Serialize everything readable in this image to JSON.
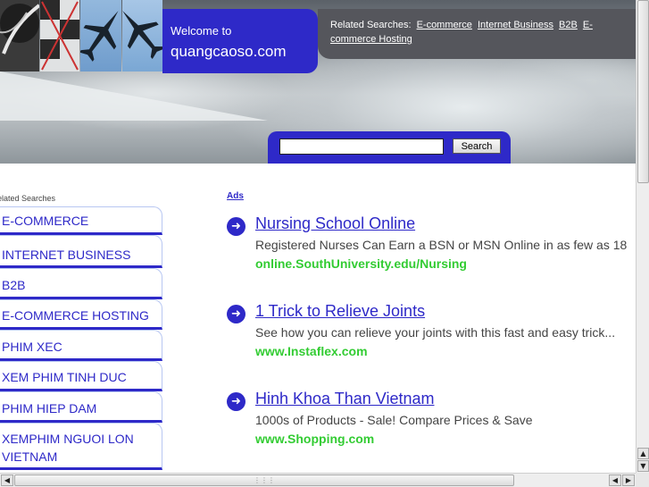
{
  "header": {
    "welcome_line1": "Welcome to",
    "welcome_line2": "quangcaoso.com",
    "related_label": "Related Searches:",
    "related_links": [
      "E-commerce",
      "Internet Business",
      "B2B",
      "E-commerce Hosting"
    ]
  },
  "search": {
    "value": "",
    "button_label": "Search"
  },
  "left": {
    "heading": "elated Searches",
    "items": [
      "E-COMMERCE",
      "INTERNET BUSINESS",
      "B2B",
      "E-COMMERCE HOSTING",
      "PHIM XEC",
      "XEM PHIM TINH DUC",
      "PHIM HIEP DAM",
      "XEMPHIM NGUOI LON VIETNAM"
    ]
  },
  "ads": {
    "label": "Ads",
    "items": [
      {
        "title": "Nursing School Online",
        "description": "Registered Nurses Can Earn a BSN or MSN Online in as few as 18",
        "url": "online.SouthUniversity.edu/Nursing"
      },
      {
        "title": "1 Trick to Relieve Joints",
        "description": "See how you can relieve your joints with this fast and easy trick...",
        "url": "www.Instaflex.com"
      },
      {
        "title": "Hinh Khoa Than Vietnam",
        "description": "1000s of Products - Sale! Compare Prices & Save",
        "url": "www.Shopping.com"
      }
    ]
  },
  "icons": {
    "ad_arrow": "arrow-right-circle-icon",
    "scroll_up": "chevron-up-icon",
    "scroll_down": "chevron-down-icon",
    "scroll_left": "chevron-left-icon",
    "scroll_right": "chevron-right-icon"
  },
  "colors": {
    "brand_blue": "#2e29c8",
    "header_gray": "#55565c",
    "url_green": "#33cc33"
  }
}
